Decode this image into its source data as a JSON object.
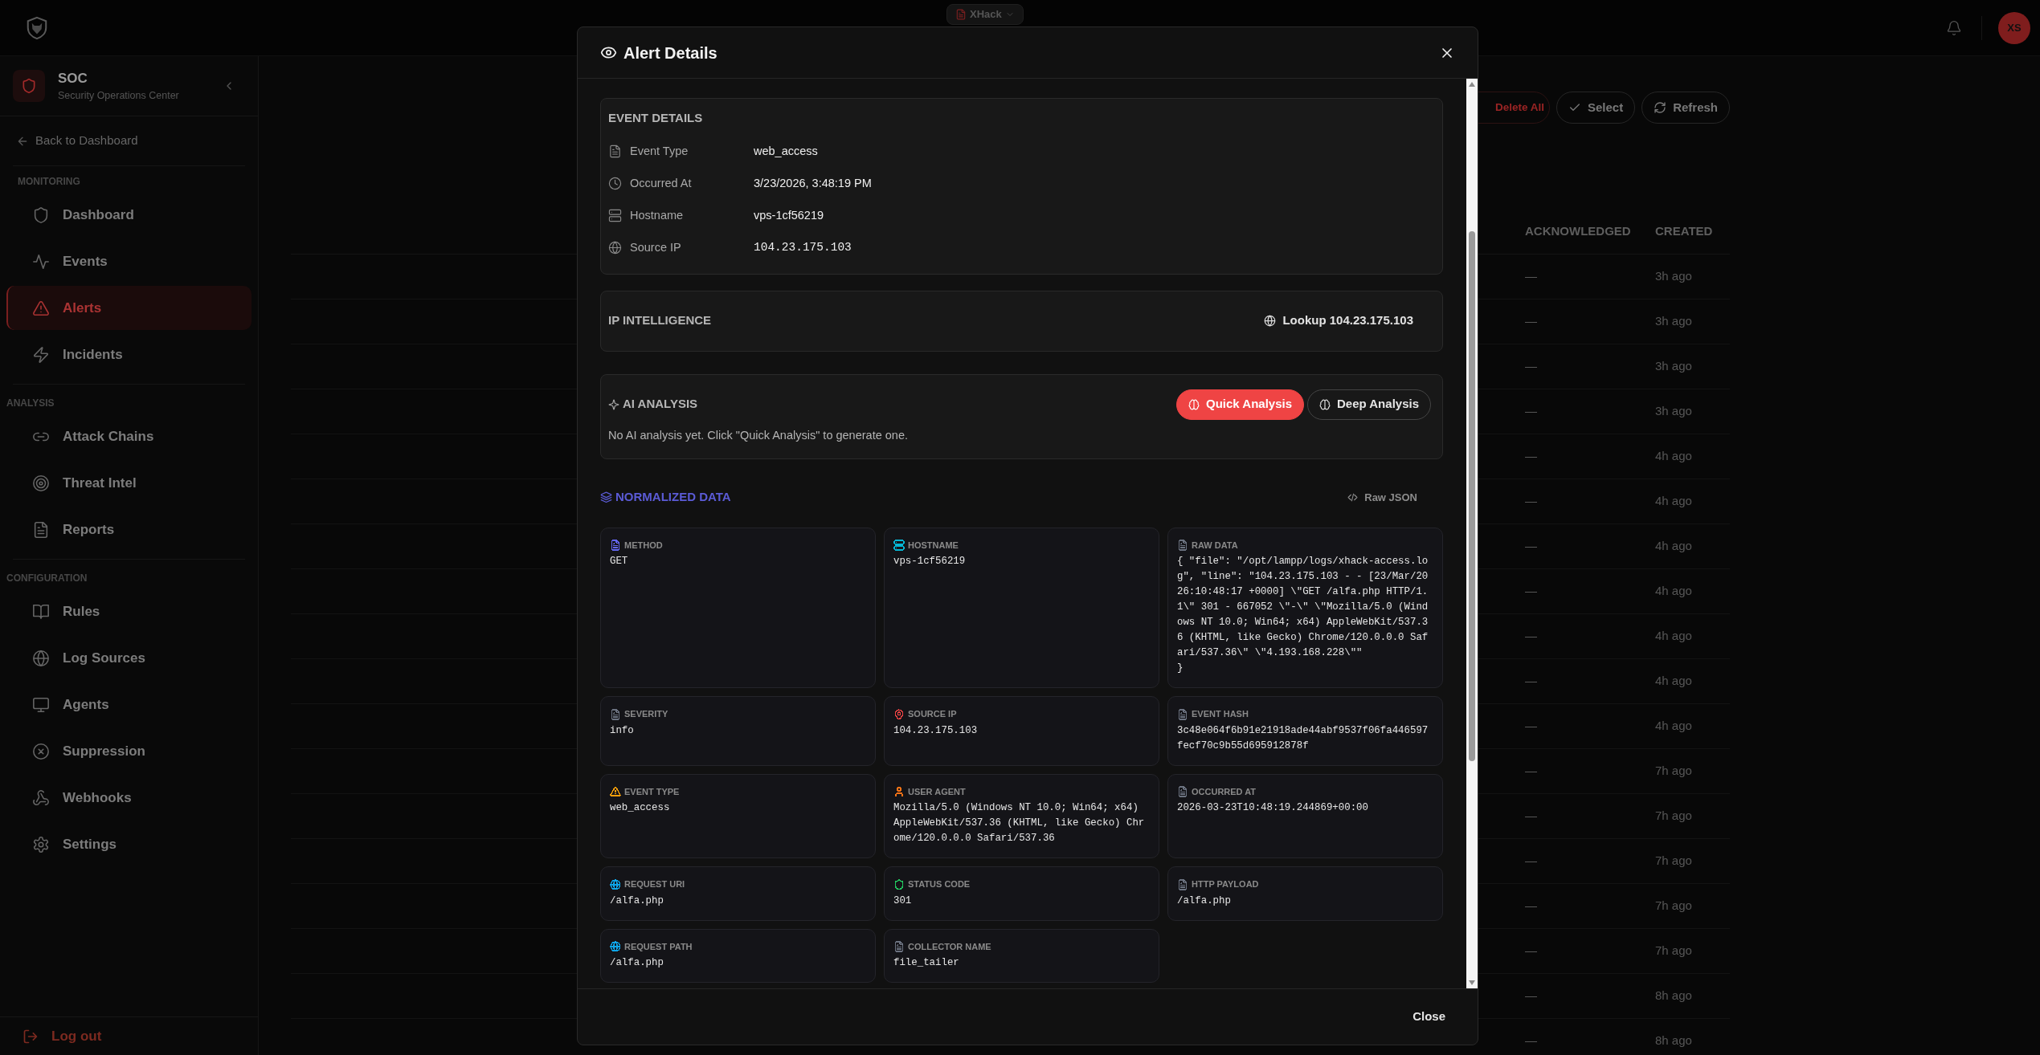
{
  "topbar": {
    "workspace": "XHack",
    "avatar": "XS"
  },
  "sidebar": {
    "org_name": "SOC",
    "org_subtitle": "Security Operations Center",
    "back_link": "Back to Dashboard",
    "sections": [
      {
        "title": "MONITORING",
        "items": [
          {
            "label": "Dashboard",
            "selected": false
          },
          {
            "label": "Events",
            "selected": false
          },
          {
            "label": "Alerts",
            "selected": true
          },
          {
            "label": "Incidents",
            "selected": false
          }
        ]
      },
      {
        "title": "ANALYSIS",
        "items": [
          {
            "label": "Attack Chains",
            "selected": false
          },
          {
            "label": "Threat Intel",
            "selected": false
          },
          {
            "label": "Reports",
            "selected": false
          }
        ]
      },
      {
        "title": "CONFIGURATION",
        "items": [
          {
            "label": "Rules",
            "selected": false
          },
          {
            "label": "Log Sources",
            "selected": false
          },
          {
            "label": "Agents",
            "selected": false
          },
          {
            "label": "Suppression",
            "selected": false
          },
          {
            "label": "Webhooks",
            "selected": false
          },
          {
            "label": "Settings",
            "selected": false
          }
        ]
      }
    ],
    "logout": "Log out"
  },
  "toolbar": {
    "buttons": [
      {
        "label": "Delete All",
        "kind": "danger"
      },
      {
        "label": "Select",
        "kind": "outline"
      },
      {
        "label": "Refresh",
        "kind": "outline"
      }
    ]
  },
  "table": {
    "columns": [
      "ACKNOWLEDGED",
      "CREATED"
    ],
    "rows": [
      {
        "acknowledged": "—",
        "created": "3h ago"
      },
      {
        "acknowledged": "—",
        "created": "3h ago"
      },
      {
        "acknowledged": "—",
        "created": "3h ago"
      },
      {
        "acknowledged": "—",
        "created": "3h ago"
      },
      {
        "acknowledged": "—",
        "created": "4h ago"
      },
      {
        "acknowledged": "—",
        "created": "4h ago"
      },
      {
        "acknowledged": "—",
        "created": "4h ago"
      },
      {
        "acknowledged": "—",
        "created": "4h ago"
      },
      {
        "acknowledged": "—",
        "created": "4h ago"
      },
      {
        "acknowledged": "—",
        "created": "4h ago"
      },
      {
        "acknowledged": "—",
        "created": "4h ago"
      },
      {
        "acknowledged": "—",
        "created": "7h ago"
      },
      {
        "acknowledged": "—",
        "created": "7h ago"
      },
      {
        "acknowledged": "—",
        "created": "7h ago"
      },
      {
        "acknowledged": "—",
        "created": "7h ago"
      },
      {
        "acknowledged": "—",
        "created": "7h ago"
      },
      {
        "acknowledged": "—",
        "created": "8h ago"
      },
      {
        "acknowledged": "—",
        "created": "8h ago"
      }
    ]
  },
  "modal": {
    "title": "Alert Details",
    "event_details": {
      "title": "EVENT DETAILS",
      "rows": [
        {
          "label": "Event Type",
          "value": "web_access",
          "kind": "text"
        },
        {
          "label": "Occurred At",
          "value": "3/23/2026, 3:48:19 PM",
          "kind": "text"
        },
        {
          "label": "Hostname",
          "value": "vps-1cf56219",
          "kind": "text"
        },
        {
          "label": "Source IP",
          "value": "104.23.175.103",
          "kind": "mono"
        }
      ]
    },
    "ip_intelligence": {
      "title": "IP INTELLIGENCE",
      "lookup_button": "Lookup 104.23.175.103"
    },
    "ai_analysis": {
      "title": "AI ANALYSIS",
      "buttons": [
        {
          "label": "Quick Analysis",
          "kind": "primary"
        },
        {
          "label": "Deep Analysis",
          "kind": "outline"
        }
      ],
      "message": "No AI analysis yet. Click \"Quick Analysis\" to generate one."
    },
    "normalized_data": {
      "title": "NORMALIZED DATA",
      "raw_json_button": "Raw JSON",
      "fields": [
        {
          "label": "METHOD",
          "value": "GET",
          "color": "#6366f1"
        },
        {
          "label": "HOSTNAME",
          "value": "vps-1cf56219",
          "color": "#06b6d4"
        },
        {
          "label": "RAW DATA",
          "value": "{ \"file\": \"/opt/lampp/logs/xhack-access.log\", \"line\": \"104.23.175.103 - - [23/Mar/2026:10:48:17 +0000] \\\"GET /alfa.php HTTP/1.1\\\" 301 - 667052 \\\"-\\\" \\\"Mozilla/5.0 (Windows NT 10.0; Win64; x64) AppleWebKit/537.36 (KHTML, like Gecko) Chrome/120.0.0.0 Safari/537.36\\\" \\\"4.193.168.228\\\"\"\n}",
          "color": "#6b7280"
        },
        {
          "label": "SEVERITY",
          "value": "info",
          "color": "#6b7280"
        },
        {
          "label": "SOURCE IP",
          "value": "104.23.175.103",
          "color": "#ef4444"
        },
        {
          "label": "EVENT HASH",
          "value": "3c48e064f6b91e21918ade44abf9537f06fa446597fecf70c9b55d695912878f",
          "color": "#6b7280"
        },
        {
          "label": "EVENT TYPE",
          "value": "web_access",
          "color": "#f59e0b"
        },
        {
          "label": "USER AGENT",
          "value": "Mozilla/5.0 (Windows NT 10.0; Win64; x64) AppleWebKit/537.36 (KHTML, like Gecko) Chrome/120.0.0.0 Safari/537.36",
          "color": "#f97316"
        },
        {
          "label": "OCCURRED AT",
          "value": "2026-03-23T10:48:19.244869+00:00",
          "color": "#6b7280"
        },
        {
          "label": "REQUEST URI",
          "value": "/alfa.php",
          "color": "#0ea5e9"
        },
        {
          "label": "STATUS CODE",
          "value": "301",
          "color": "#22c55e"
        },
        {
          "label": "HTTP PAYLOAD",
          "value": "/alfa.php",
          "color": "#6b7280"
        },
        {
          "label": "REQUEST PATH",
          "value": "/alfa.php",
          "color": "#0ea5e9"
        },
        {
          "label": "COLLECTOR NAME",
          "value": "file_tailer",
          "color": "#6b7280"
        }
      ]
    },
    "footer_button": "Close"
  }
}
